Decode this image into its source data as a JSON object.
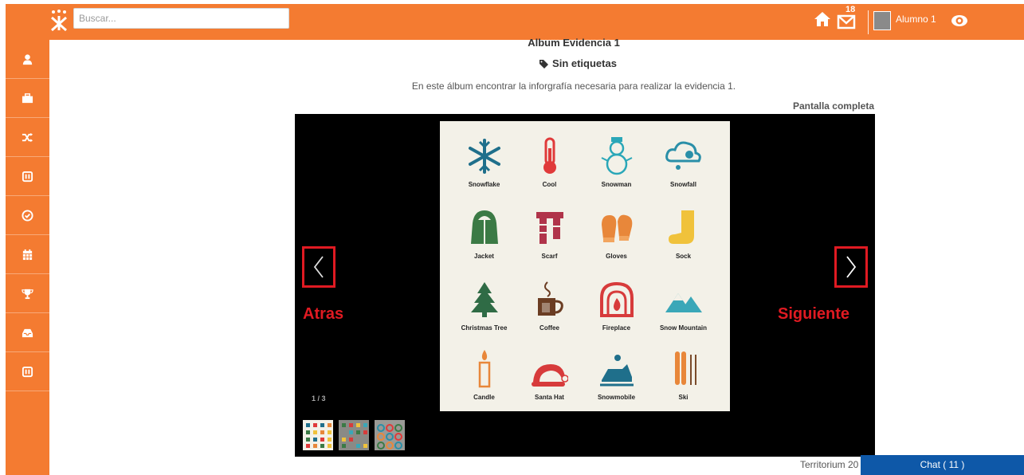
{
  "header": {
    "search_placeholder": "Buscar...",
    "mail_count": "18",
    "user_name": "Alumno 1"
  },
  "sidebar": {
    "items": [
      {
        "icon": "user-icon"
      },
      {
        "icon": "briefcase-icon"
      },
      {
        "icon": "shuffle-icon"
      },
      {
        "icon": "panel-icon"
      },
      {
        "icon": "check-circle-icon"
      },
      {
        "icon": "calendar-icon"
      },
      {
        "icon": "trophy-icon"
      },
      {
        "icon": "inbox-icon"
      },
      {
        "icon": "panel-icon"
      }
    ]
  },
  "album": {
    "title": "Album Evidencia 1",
    "tags": "Sin etiquetas",
    "description": "En este álbum encontrar la inforgrafía necesaria para realizar la evidencia 1.",
    "fullscreen": "Pantalla completa"
  },
  "viewer": {
    "prev_label": "Atras",
    "next_label": "Siguiente",
    "counter": "1 / 3",
    "items": [
      "Snowflake",
      "Cool",
      "Snowman",
      "Snowfall",
      "Jacket",
      "Scarf",
      "Gloves",
      "Sock",
      "Christmas Tree",
      "Coffee",
      "Fireplace",
      "Snow Mountain",
      "Candle",
      "Santa Hat",
      "Snowmobile",
      "Ski"
    ],
    "thumbnails": 3
  },
  "footer": {
    "text": "Territorium 20",
    "chat": "Chat ( 11 )"
  },
  "colors": {
    "brand": "#f47b31",
    "accent_red": "#e01a22",
    "chat_blue": "#0e58a8"
  }
}
